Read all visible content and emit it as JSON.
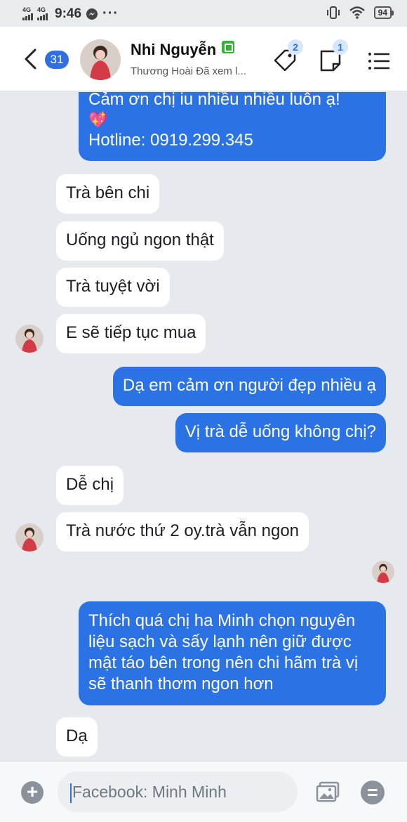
{
  "status": {
    "signal_left": "4G",
    "signal_right": "4G",
    "time": "9:46",
    "more": "···",
    "battery": "94"
  },
  "header": {
    "unread_count": "31",
    "contact_name": "Nhi Nguyễn",
    "subtitle": "Thương Hoài Đã xem l...",
    "tag_badge": "2",
    "note_badge": "1"
  },
  "messages": [
    {
      "dir": "out",
      "text": "Cảm ơn chị iu nhiều nhiều luôn ạ!",
      "emoji": "💖",
      "hotline": "Hotline: 0919.299.345"
    },
    {
      "dir": "in",
      "text": "Trà bên chi"
    },
    {
      "dir": "in",
      "text": "Uống ngủ ngon thật"
    },
    {
      "dir": "in",
      "text": "Trà tuyệt vời"
    },
    {
      "dir": "in",
      "text": "E sẽ tiếp tục mua"
    },
    {
      "dir": "out",
      "text": "Dạ em cảm ơn người đẹp nhiều ạ"
    },
    {
      "dir": "out",
      "text": "Vị trà dễ uống không chị?"
    },
    {
      "dir": "in",
      "text": "Dễ chị"
    },
    {
      "dir": "in",
      "text": "Trà nước thứ 2 oy.trà vẫn ngon"
    },
    {
      "dir": "out",
      "lines": [
        "Thích quá chị ha Minh chọn nguyên",
        "liệu sạch và sấy lạnh nên giữ được",
        "mật táo bên trong nên chi hãm trà vị",
        "sẽ thanh thơm ngon hơn"
      ]
    },
    {
      "dir": "in",
      "text": "Dạ"
    }
  ],
  "composer": {
    "placeholder": "Facebook: Minh Minh"
  },
  "colors": {
    "outgoing": "#2b72e5",
    "incoming": "#ffffff",
    "chat_bg": "#e6eaee",
    "accent": "#2f6fe0"
  },
  "icons": {
    "back": "chevron-left-icon",
    "tag": "tag-icon",
    "note": "note-icon",
    "menu": "menu-icon",
    "add": "plus-circle-icon",
    "image": "image-icon",
    "quick_reply": "chat-icon"
  }
}
